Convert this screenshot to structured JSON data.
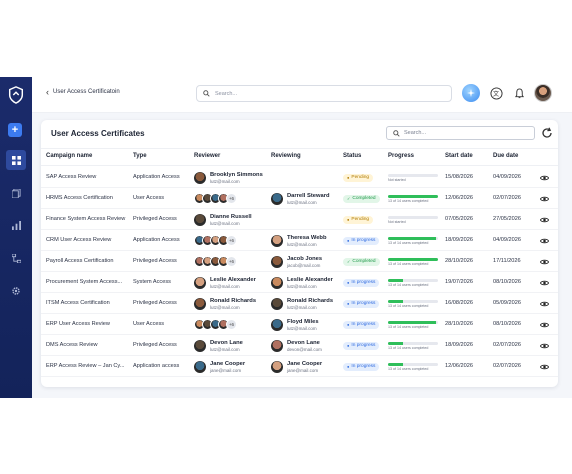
{
  "header": {
    "back_label": "User Access Certificatoin",
    "search_placeholder": "Search..."
  },
  "card": {
    "title": "User Access Certificates",
    "search_placeholder": "Search..."
  },
  "columns": [
    "Campaign name",
    "Type",
    "Reviewer",
    "Reviewing",
    "Status",
    "Progress",
    "Start date",
    "Due date"
  ],
  "rows": [
    {
      "campaign": "SAP Access Review",
      "type": "Application Access",
      "reviewer_name": "Brooklyn Simmons",
      "reviewer_email": "lutz@mail.com",
      "reviewer_group": false,
      "reviewer_more": "",
      "reviewing_name": "",
      "reviewing_email": "",
      "status": "Pending",
      "progress": 0,
      "progress_text": "Not started",
      "start": "15/08/2026",
      "due": "04/09/2026"
    },
    {
      "campaign": "HRMS Access Certification",
      "type": "User Access",
      "reviewer_name": "",
      "reviewer_email": "",
      "reviewer_group": true,
      "reviewer_more": "+6",
      "reviewing_name": "Darrell Steward",
      "reviewing_email": "lutz@mail.com",
      "status": "Completed",
      "progress": 1.0,
      "progress_text": "13 of 14 users completed",
      "start": "12/06/2026",
      "due": "02/07/2026"
    },
    {
      "campaign": "Finance System Access Review",
      "type": "Privileged Access",
      "reviewer_name": "Dianne Russell",
      "reviewer_email": "lutz@mail.com",
      "reviewer_group": false,
      "reviewer_more": "",
      "reviewing_name": "",
      "reviewing_email": "",
      "status": "Pending",
      "progress": 0,
      "progress_text": "Not started",
      "start": "07/05/2026",
      "due": "27/05/2026"
    },
    {
      "campaign": "CRM User Access Review",
      "type": "Application Access",
      "reviewer_name": "",
      "reviewer_email": "",
      "reviewer_group": true,
      "reviewer_more": "+6",
      "reviewing_name": "Theresa Webb",
      "reviewing_email": "lutz@mail.com",
      "status": "In progress",
      "progress": 0.95,
      "progress_text": "13 of 14 users completed",
      "start": "18/09/2026",
      "due": "04/09/2026"
    },
    {
      "campaign": "Payroll Access Certification",
      "type": "Privileged Access",
      "reviewer_name": "",
      "reviewer_email": "",
      "reviewer_group": true,
      "reviewer_more": "+6",
      "reviewing_name": "Jacob Jones",
      "reviewing_email": "jacob@mail.com",
      "status": "Completed",
      "progress": 1.0,
      "progress_text": "13 of 14 users completed",
      "start": "28/10/2026",
      "due": "17/11/2026"
    },
    {
      "campaign": "Procurement System Access...",
      "type": "System Access",
      "reviewer_name": "Leslie Alexander",
      "reviewer_email": "lutz@mail.com",
      "reviewer_group": false,
      "reviewer_more": "",
      "reviewing_name": "Leslie Alexander",
      "reviewing_email": "lutz@mail.com",
      "status": "In progress",
      "progress": 0.3,
      "progress_text": "13 of 14 users completed",
      "start": "19/07/2026",
      "due": "08/10/2026"
    },
    {
      "campaign": "ITSM Access Certification",
      "type": "Privileged Access",
      "reviewer_name": "Ronald Richards",
      "reviewer_email": "lutz@mail.com",
      "reviewer_group": false,
      "reviewer_more": "",
      "reviewing_name": "Ronald Richards",
      "reviewing_email": "lutz@mail.com",
      "status": "In progress",
      "progress": 0.3,
      "progress_text": "13 of 14 users completed",
      "start": "16/08/2026",
      "due": "05/09/2026"
    },
    {
      "campaign": "ERP User Access Review",
      "type": "User Access",
      "reviewer_name": "",
      "reviewer_email": "",
      "reviewer_group": true,
      "reviewer_more": "+6",
      "reviewing_name": "Floyd Miles",
      "reviewing_email": "lutz@mail.com",
      "status": "In progress",
      "progress": 0.95,
      "progress_text": "13 of 14 users completed",
      "start": "28/10/2026",
      "due": "08/10/2026"
    },
    {
      "campaign": "DMS Access Review",
      "type": "Privileged Access",
      "reviewer_name": "Devon Lane",
      "reviewer_email": "lutz@mail.com",
      "reviewer_group": false,
      "reviewer_more": "",
      "reviewing_name": "Devon Lane",
      "reviewing_email": "devon@mail.com",
      "status": "In progress",
      "progress": 0.3,
      "progress_text": "13 of 14 users completed",
      "start": "18/09/2026",
      "due": "02/07/2026"
    },
    {
      "campaign": "ERP Access Review – Jan Cy...",
      "type": "Application access",
      "reviewer_name": "Jane Cooper",
      "reviewer_email": "jane@mail.com",
      "reviewer_group": false,
      "reviewer_more": "",
      "reviewing_name": "Jane Cooper",
      "reviewing_email": "jane@mail.com",
      "status": "In progress",
      "progress": 0.3,
      "progress_text": "13 of 14 users completed",
      "start": "12/06/2026",
      "due": "02/07/2026"
    }
  ],
  "colors": {
    "sidebar": "#16275f",
    "accent": "#3c7bf0",
    "pending_bg": "#fff4d6",
    "pending_fg": "#b07a00",
    "completed_bg": "#e2f6e8",
    "completed_fg": "#1f9a4a",
    "progress_bg": "#e3edfd",
    "progress_fg": "#2f6be0",
    "progress_fill": "#2fbe5a"
  }
}
